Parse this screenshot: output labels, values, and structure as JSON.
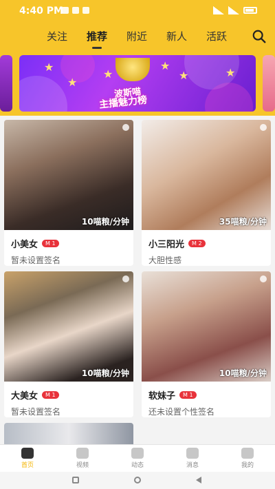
{
  "status_bar": {
    "time": "4:40 PM"
  },
  "top_nav": {
    "tabs": [
      {
        "label": "关注"
      },
      {
        "label": "推荐",
        "active": true
      },
      {
        "label": "附近"
      },
      {
        "label": "新人"
      },
      {
        "label": "活跃"
      }
    ]
  },
  "banner": {
    "line1": "波斯喵",
    "line2": "主播魅力榜"
  },
  "cards": [
    {
      "name": "小美女",
      "level": "M 1",
      "signature": "暂未设置签名",
      "price": "10喵粮/分钟"
    },
    {
      "name": "小三阳光",
      "level": "M 2",
      "signature": "大胆性感",
      "price": "35喵粮/分钟"
    },
    {
      "name": "大美女",
      "level": "M 1",
      "signature": "暂未设置签名",
      "price": "10喵粮/分钟"
    },
    {
      "name": "软妹子",
      "level": "M 1",
      "signature": "还未设置个性签名",
      "price": "10喵粮/分钟"
    }
  ],
  "bottom_nav": {
    "items": [
      {
        "label": "首页",
        "active": true
      },
      {
        "label": "视频"
      },
      {
        "label": "动态"
      },
      {
        "label": "消息"
      },
      {
        "label": "我的"
      }
    ]
  },
  "colors": {
    "brand": "#f7c52a",
    "level_badge": "#e8333b",
    "active_label": "#f4b400"
  }
}
